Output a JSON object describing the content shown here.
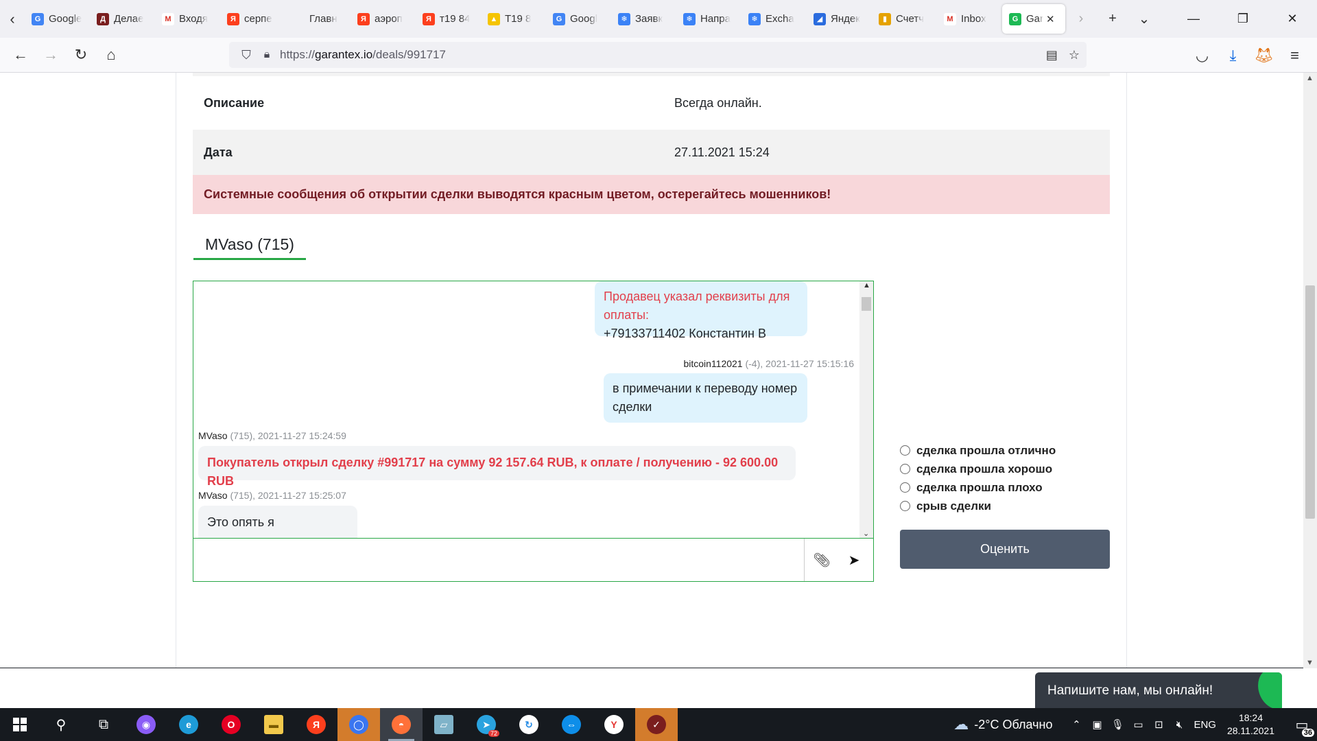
{
  "browser": {
    "tabs": [
      {
        "label": "Google",
        "fav_color": "#4285f4",
        "fav_text": "G"
      },
      {
        "label": "Делае",
        "fav_color": "#7a1e1e",
        "fav_text": "Д"
      },
      {
        "label": "Входя",
        "fav_color": "#ffffff",
        "fav_text": "M"
      },
      {
        "label": "серпе",
        "fav_color": "#fc3f1d",
        "fav_text": "Я"
      },
      {
        "label": "Главн",
        "fav_color": "#f0f0f4",
        "fav_text": ""
      },
      {
        "label": "аэроп",
        "fav_color": "#fc3f1d",
        "fav_text": "Я"
      },
      {
        "label": "т19 84",
        "fav_color": "#fc3f1d",
        "fav_text": "Я"
      },
      {
        "label": "T19 8",
        "fav_color": "#f5c400",
        "fav_text": "▲"
      },
      {
        "label": "Googl",
        "fav_color": "#4285f4",
        "fav_text": "G"
      },
      {
        "label": "Заявк",
        "fav_color": "#3b82f6",
        "fav_text": "❄"
      },
      {
        "label": "Напра",
        "fav_color": "#3b82f6",
        "fav_text": "❄"
      },
      {
        "label": "Excha",
        "fav_color": "#3b82f6",
        "fav_text": "❄"
      },
      {
        "label": "Яндек",
        "fav_color": "#2b6cde",
        "fav_text": "◢"
      },
      {
        "label": "Счетч",
        "fav_color": "#e5a200",
        "fav_text": "▮"
      },
      {
        "label": "Inbox",
        "fav_color": "#ffffff",
        "fav_text": "M"
      }
    ],
    "active_tab": {
      "label": "Gar",
      "fav_color": "#1db954",
      "fav_text": "G"
    },
    "url_prefix": "https://",
    "url_host": "garantex.io",
    "url_path": "/deals/991717"
  },
  "deal": {
    "desc_label": "Описание",
    "desc_value": "Всегда онлайн.",
    "date_label": "Дата",
    "date_value": "27.11.2021 15:24",
    "alert": "Системные сообщения об открытии сделки выводятся красным цветом, остерегайтесь мошенников!"
  },
  "counterparty_tab": "MVaso (715)",
  "chat": {
    "messages": [
      {
        "side": "right",
        "red_text": "Продавец указал реквизиты для оплаты:",
        "text": "+79133711402 Константин В"
      },
      {
        "side": "right",
        "author": "bitcoin112021",
        "meta": "(-4), 2021-11-27 15:15:16",
        "text": "в примечании к переводу номер сделки"
      },
      {
        "side": "left",
        "author": "MVaso",
        "meta": "(715), 2021-11-27 15:24:59",
        "system_text": "Покупатель открыл сделку #991717 на сумму 92 157.64 RUB, к оплате / получению - 92 600.00 RUB"
      },
      {
        "side": "left",
        "author": "MVaso",
        "meta": "(715), 2021-11-27 15:25:07",
        "text": "Это опять я"
      }
    ]
  },
  "rating": {
    "options": [
      "сделка прошла отлично",
      "сделка прошла хорошо",
      "сделка прошла плохо",
      "срыв сделки"
    ],
    "submit_label": "Оценить"
  },
  "widget": {
    "label": "Напишите нам, мы онлайн!"
  },
  "taskbar": {
    "weather": "-2°C Облачно",
    "lang": "ENG",
    "time": "18:24",
    "date": "28.11.2021",
    "notif_count": "36",
    "telegram_badge": "72"
  }
}
